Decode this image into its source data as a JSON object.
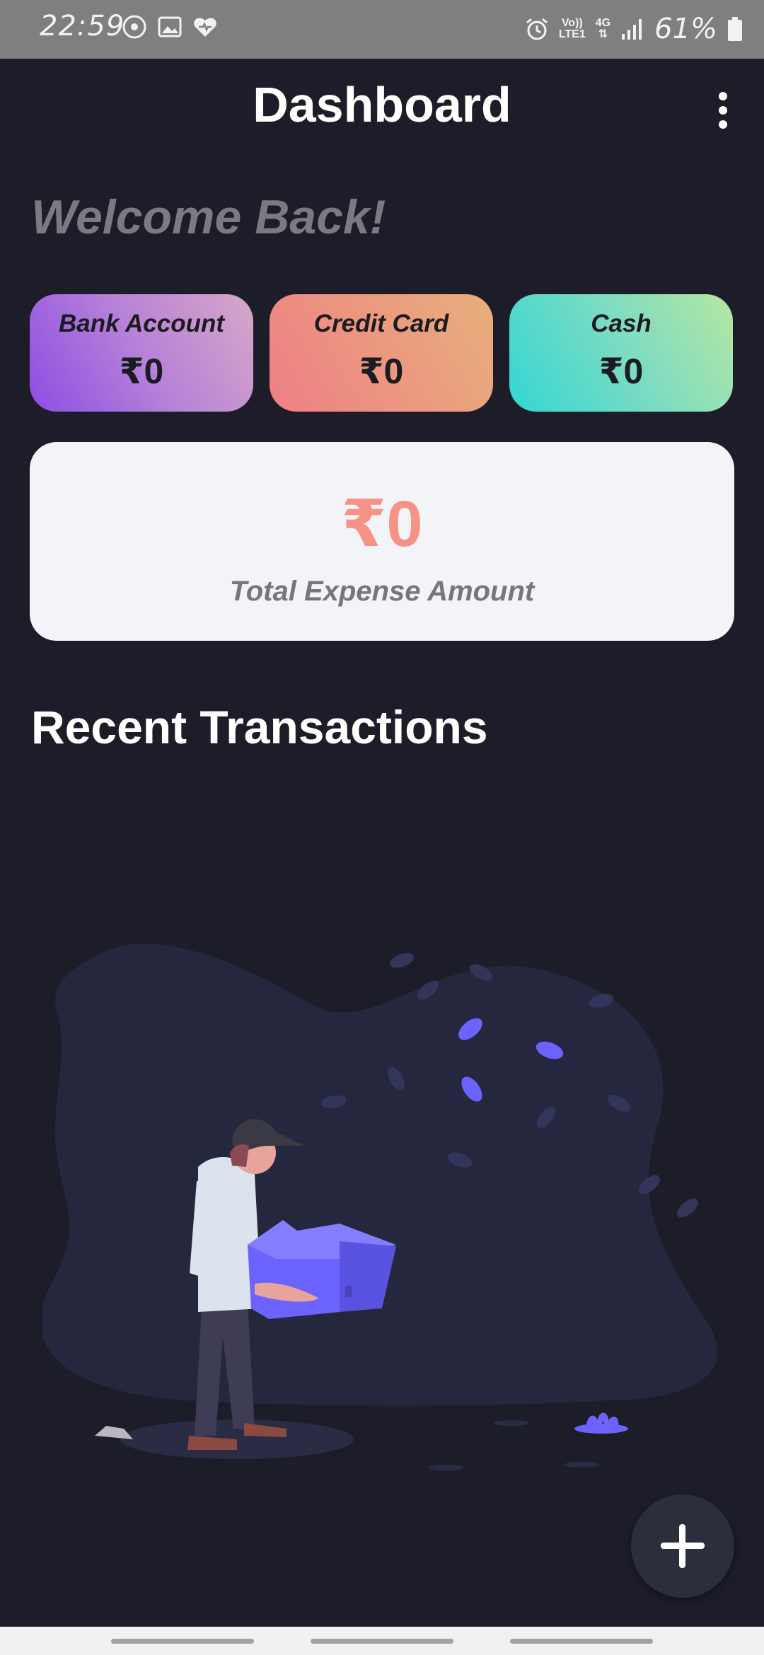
{
  "status_bar": {
    "time": "22:59",
    "network_top": "Vo))",
    "network_bottom": "LTE1",
    "signal_type": "4G",
    "battery": "61%",
    "icons": [
      "music-icon",
      "gallery-icon",
      "health-icon",
      "alarm-icon",
      "signal-icon",
      "battery-icon"
    ]
  },
  "appbar": {
    "title": "Dashboard"
  },
  "welcome": "Welcome Back!",
  "accounts": [
    {
      "label": "Bank Account",
      "amount": "₹0"
    },
    {
      "label": "Credit Card",
      "amount": "₹0"
    },
    {
      "label": "Cash",
      "amount": "₹0"
    }
  ],
  "total": {
    "amount": "₹0",
    "label": "Total Expense Amount"
  },
  "section": {
    "title": "Recent Transactions"
  },
  "colors": {
    "background": "#1c1d28",
    "total_amount": "#f69386",
    "accent_purple": "#6c63ff"
  }
}
